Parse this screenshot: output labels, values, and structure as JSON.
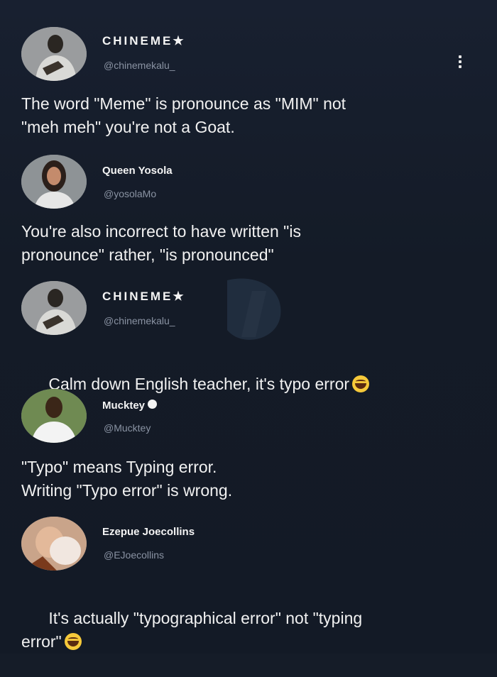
{
  "posts": [
    {
      "name": "CHINEME",
      "name_suffix": "★",
      "handle": "@chinemekalu_",
      "text": "The word \"Meme\" is pronounce as \"MIM\" not\n\"meh meh\" you're not a Goat.",
      "avatar_icon": "man-portrait-avatar"
    },
    {
      "name": "Queen Yosola",
      "name_suffix": "",
      "handle": "@yosolaMo",
      "text": "You're also incorrect to have written \"is\npronounce\" rather, \"is pronounced\"",
      "avatar_icon": "woman-portrait-avatar"
    },
    {
      "name": "CHINEME",
      "name_suffix": "★",
      "handle": "@chinemekalu_",
      "text": "Calm down English teacher, it's typo error",
      "emoji": "laughing-emoji",
      "avatar_icon": "man-portrait-avatar"
    },
    {
      "name": "Mucktey",
      "name_suffix": "",
      "verified_icon": "verified-badge-icon",
      "handle": "@Mucktey",
      "text": "\"Typo\" means Typing error.\nWriting \"Typo error\" is wrong.",
      "avatar_icon": "man-white-shirt-avatar"
    },
    {
      "name": "Ezepue Joecollins",
      "name_suffix": "",
      "handle": "@EJoecollins",
      "text": "It's actually \"typographical error\" not \"typing\nerror\"",
      "emoji": "grinning-emoji",
      "avatar_icon": "baby-portrait-avatar"
    }
  ],
  "menu_icon": "more-options-icon",
  "colors": {
    "background": "#151c28",
    "text": "#f1f1f1",
    "handle": "#8a93a3",
    "emoji": "#f6c93a"
  }
}
